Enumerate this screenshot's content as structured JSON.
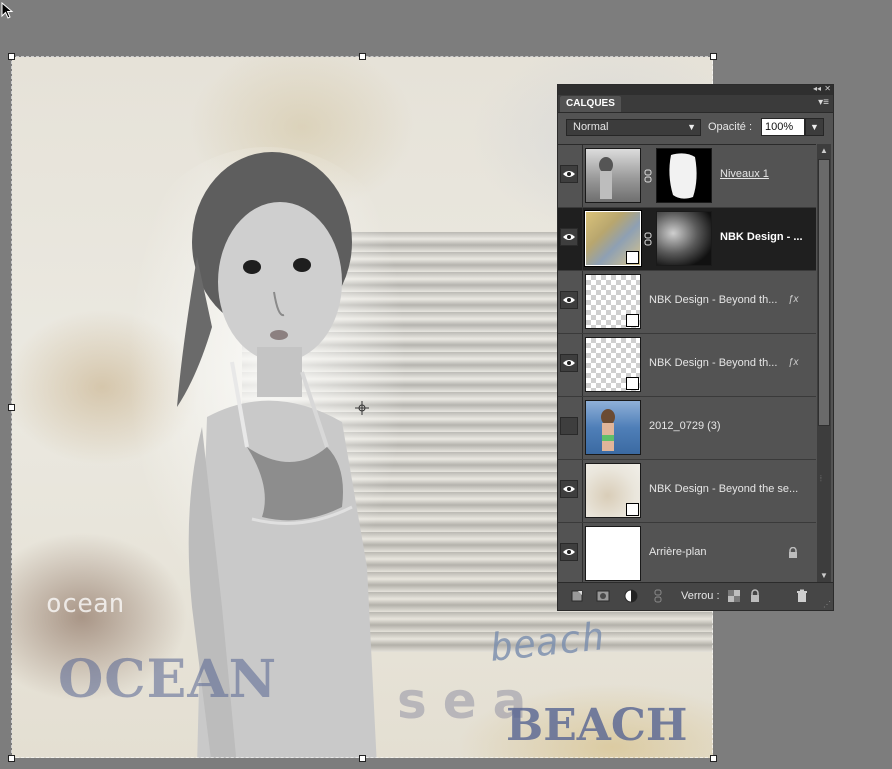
{
  "canvas": {
    "text_ocean_script": "ocean",
    "text_ocean": "OCEAN",
    "text_sea": "sea",
    "text_beach_script": "beach",
    "text_beach": "BEACH"
  },
  "panel": {
    "tab_label": "CALQUES",
    "blend_mode": "Normal",
    "opacity_label": "Opacité :",
    "opacity_value": "100%",
    "lock_label": "Verrou :",
    "layers": [
      {
        "name": "Niveaux 1",
        "visible": true,
        "has_mask": true,
        "selected": false
      },
      {
        "name": "NBK Design - ...",
        "visible": true,
        "has_mask": true,
        "selected": true
      },
      {
        "name": "NBK Design - Beyond th...",
        "visible": true,
        "fx": true
      },
      {
        "name": "NBK Design - Beyond th...",
        "visible": true,
        "fx": true
      },
      {
        "name": "2012_0729 (3)",
        "visible": false
      },
      {
        "name": "NBK Design - Beyond the se...",
        "visible": true
      },
      {
        "name": "Arrière-plan",
        "visible": true,
        "locked": true
      }
    ]
  },
  "colors": {
    "app_bg": "#7d7d7d",
    "panel_bg": "#535353",
    "selected_row": "#1f1f1f"
  }
}
